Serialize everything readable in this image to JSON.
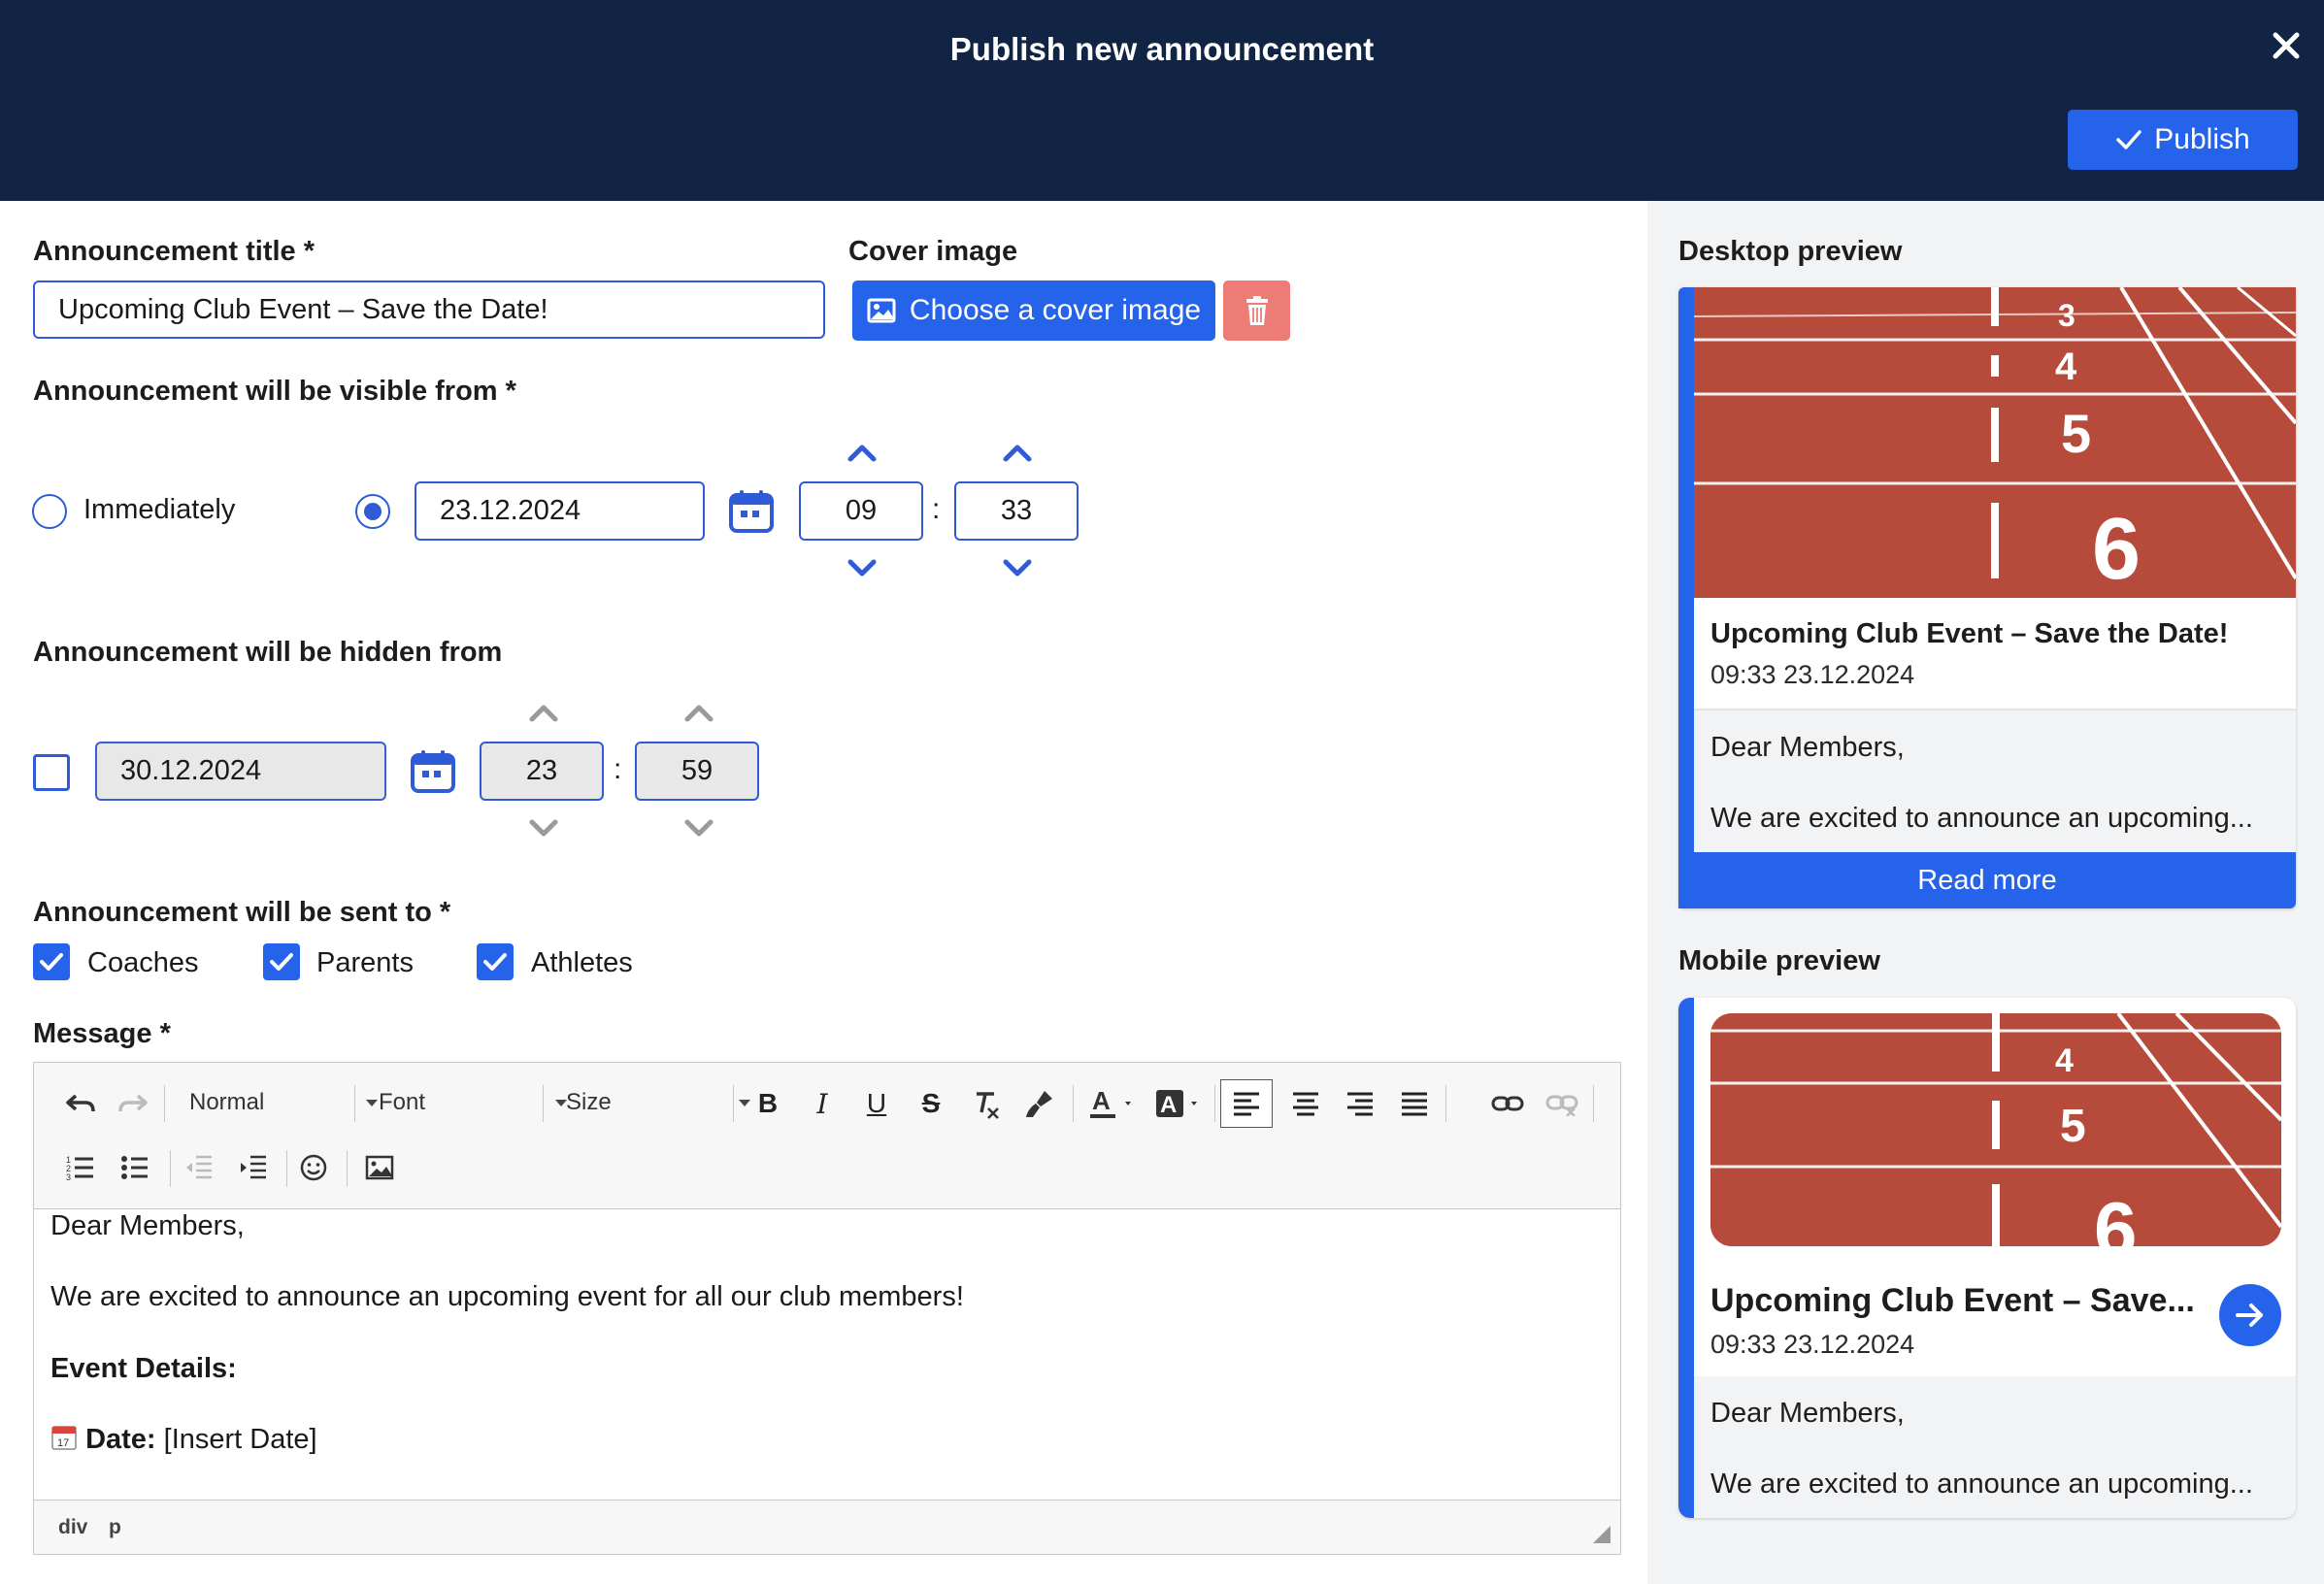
{
  "header": {
    "title": "Publish new announcement",
    "publish_label": "Publish"
  },
  "form": {
    "title_label": "Announcement title *",
    "title_value": "Upcoming Club Event – Save the Date!",
    "cover_label": "Cover image",
    "cover_button": "Choose a cover image",
    "visible_label": "Announcement will be visible from *",
    "immediately_label": "Immediately",
    "visible_mode": "scheduled",
    "visible_date": "23.12.2024",
    "visible_hour": "09",
    "visible_minute": "33",
    "hidden_label": "Announcement will be hidden from",
    "hidden_enabled": false,
    "hidden_date": "30.12.2024",
    "hidden_hour": "23",
    "hidden_minute": "59",
    "colon": ":",
    "sent_label": "Announcement will be sent to *",
    "recipients": [
      {
        "label": "Coaches",
        "checked": true
      },
      {
        "label": "Parents",
        "checked": true
      },
      {
        "label": "Athletes",
        "checked": true
      }
    ],
    "message_label": "Message *"
  },
  "editor": {
    "format_select": "Normal",
    "font_select": "Font",
    "size_select": "Size",
    "body": {
      "greeting": "Dear Members,",
      "intro": "We are excited to announce an upcoming event for all our club members!",
      "details_heading": "Event Details:",
      "date_label": "Date:",
      "date_value": " [Insert Date]"
    },
    "path": [
      "div",
      "p"
    ]
  },
  "preview": {
    "desktop_label": "Desktop preview",
    "mobile_label": "Mobile preview",
    "desktop_title": "Upcoming Club Event – Save the Date!",
    "mobile_title": "Upcoming Club Event – Save...",
    "timestamp": "09:33 23.12.2024",
    "greeting": "Dear Members,",
    "excerpt": "We are excited to announce an upcoming...",
    "read_more": "Read more"
  },
  "colors": {
    "header_bg": "#112444",
    "primary": "#2563eb",
    "danger": "#ee7c76",
    "preview_bg": "#f2f3f5"
  }
}
